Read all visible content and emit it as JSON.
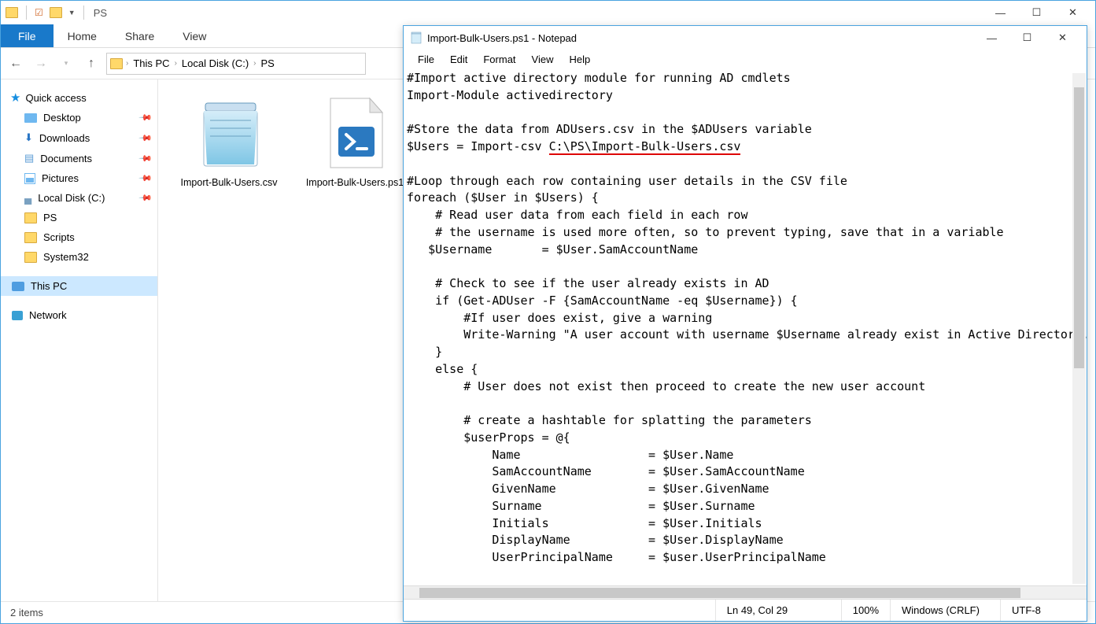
{
  "explorer": {
    "title": "PS",
    "tabs": {
      "file": "File",
      "home": "Home",
      "share": "Share",
      "view": "View"
    },
    "breadcrumb": [
      "This PC",
      "Local Disk (C:)",
      "PS"
    ],
    "nav": {
      "quick_access": "Quick access",
      "items": [
        {
          "label": "Desktop",
          "pin": true
        },
        {
          "label": "Downloads",
          "pin": true
        },
        {
          "label": "Documents",
          "pin": true
        },
        {
          "label": "Pictures",
          "pin": true
        },
        {
          "label": "Local Disk (C:)",
          "pin": true
        },
        {
          "label": "PS",
          "pin": false
        },
        {
          "label": "Scripts",
          "pin": false
        },
        {
          "label": "System32",
          "pin": false
        }
      ],
      "this_pc": "This PC",
      "network": "Network"
    },
    "files": [
      {
        "name": "Import-Bulk-Users.csv",
        "type": "csv"
      },
      {
        "name": "Import-Bulk-Users.ps1",
        "type": "ps1"
      }
    ],
    "status": "2 items"
  },
  "notepad": {
    "title": "Import-Bulk-Users.ps1 - Notepad",
    "menu": [
      "File",
      "Edit",
      "Format",
      "View",
      "Help"
    ],
    "code_pre": "#Import active directory module for running AD cmdlets\nImport-Module activedirectory\n\n#Store the data from ADUsers.csv in the $ADUsers variable\n$Users = Import-csv ",
    "code_highlight": "C:\\PS\\Import-Bulk-Users.csv",
    "code_post": "\n\n#Loop through each row containing user details in the CSV file\nforeach ($User in $Users) {\n    # Read user data from each field in each row\n    # the username is used more often, so to prevent typing, save that in a variable\n   $Username       = $User.SamAccountName\n\n    # Check to see if the user already exists in AD\n    if (Get-ADUser -F {SamAccountName -eq $Username}) {\n        #If user does exist, give a warning\n        Write-Warning \"A user account with username $Username already exist in Active Directory.\"\n    }\n    else {\n        # User does not exist then proceed to create the new user account\n\n        # create a hashtable for splatting the parameters\n        $userProps = @{\n            Name                  = $User.Name\n            SamAccountName        = $User.SamAccountName\n            GivenName             = $User.GivenName\n            Surname               = $User.Surname\n            Initials              = $User.Initials\n            DisplayName           = $User.DisplayName\n            UserPrincipalName     = $user.UserPrincipalName",
    "status": {
      "pos": "Ln 49, Col 29",
      "zoom": "100%",
      "eol": "Windows (CRLF)",
      "enc": "UTF-8"
    }
  }
}
